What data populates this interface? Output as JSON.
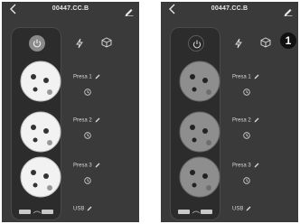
{
  "header": {
    "title": "00447.CC.B"
  },
  "outlets": [
    {
      "label": "Presa 1"
    },
    {
      "label": "Presa 2"
    },
    {
      "label": "Presa 3"
    }
  ],
  "usb": {
    "label": "USB"
  },
  "states": {
    "left": "on",
    "right": "off"
  },
  "colors": {
    "on_outlet": "#f2f2f2",
    "off_outlet": "#8e8e8e",
    "background": "#3a3a3a"
  },
  "annotation": {
    "badge": "1"
  }
}
